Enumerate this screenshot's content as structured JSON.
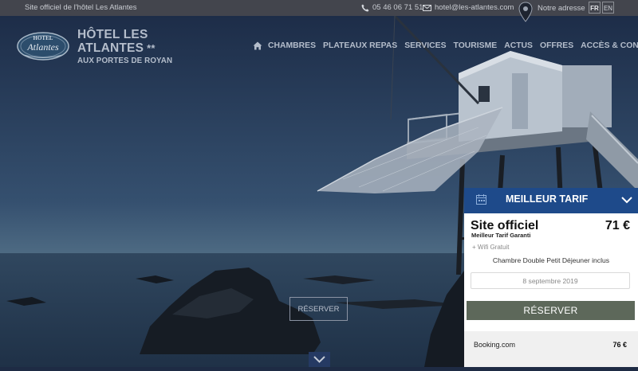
{
  "colors": {
    "topbar_bg": "#46484e",
    "hero_sky": "#1e2b44",
    "nav_text": "#b4bdcb",
    "widget_header": "#1e4a8a",
    "reserve_button": "#5d685a",
    "widget_footer": "#f0f0f0"
  },
  "topbar": {
    "tagline": "Site officiel de l'hôtel Les Atlantes",
    "phone": "05 46 06 71 51",
    "phone_icon": "phone-icon",
    "email": "hotel@les-atlantes.com",
    "email_icon": "envelope-icon",
    "address_label": "Notre adresse",
    "address_icon": "map-pin-icon",
    "languages": [
      "FR",
      "EN"
    ]
  },
  "brand": {
    "logo_text": "Hotel Atlantes",
    "line1": "HÔTEL LES",
    "line2": "ATLANTES",
    "stars": "**",
    "line3": "AUX PORTES DE ROYAN"
  },
  "nav": {
    "home_icon": "home-icon",
    "items": [
      "CHAMBRES",
      "PLATEAUX REPAS",
      "SERVICES",
      "TOURISME",
      "ACTUS",
      "OFFRES",
      "ACCÈS & CONTACT"
    ]
  },
  "hero": {
    "reserve_label": "RÉSERVER",
    "scroll_icon": "chevron-down-icon"
  },
  "widget": {
    "header_title": "MEILLEUR TARIF",
    "calendar_icon": "calendar-icon",
    "toggle_icon": "chevron-down-icon",
    "site_label": "Site officiel",
    "price": "71 €",
    "subtitle": "Meilleur Tarif Garanti",
    "perk": "+ Wifi Gratuit",
    "room": "Chambre Double Petit Déjeuner inclus",
    "date": "8 septembre 2019",
    "reserve_label": "RÉSERVER",
    "compare": [
      {
        "name": "Booking.com",
        "price": "76 €"
      }
    ]
  }
}
